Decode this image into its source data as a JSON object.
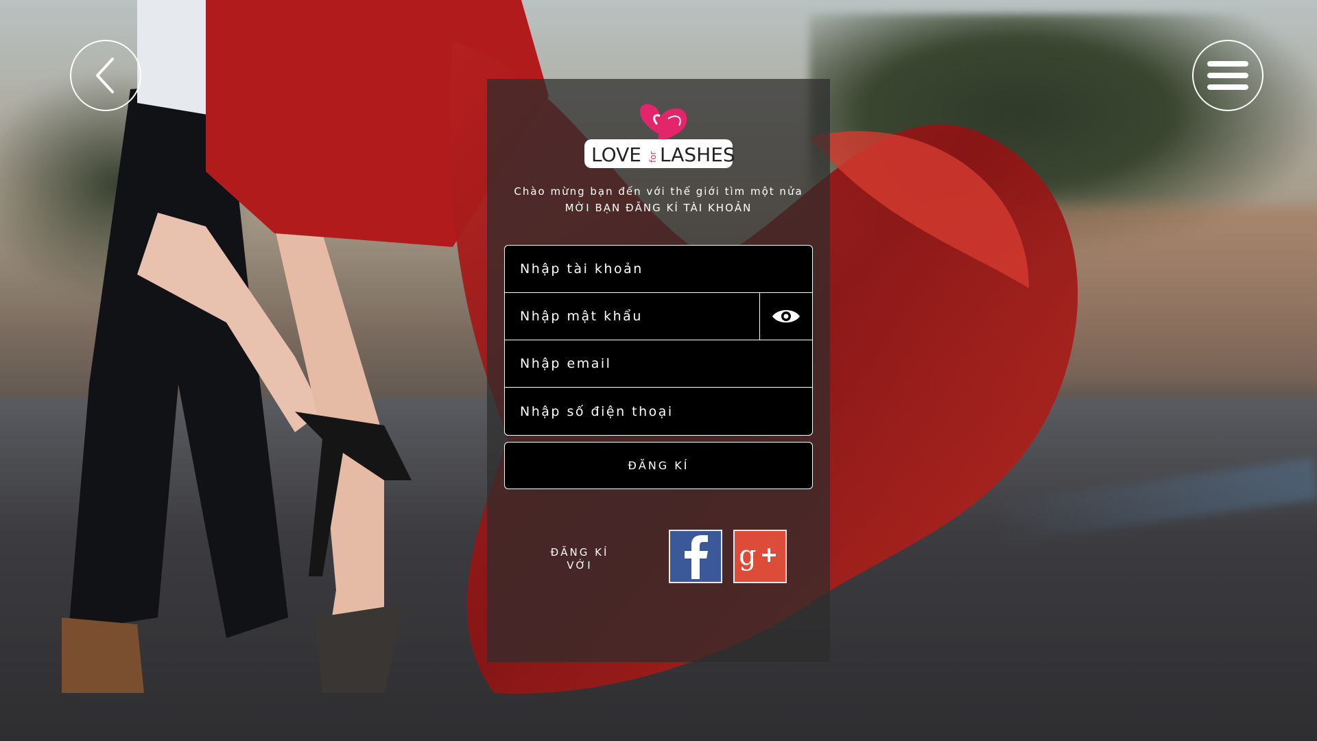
{
  "header": {
    "back_icon": "chevron-left-icon",
    "menu_icon": "hamburger-menu-icon"
  },
  "logo": {
    "text_love": "LOVE",
    "text_for": "for",
    "text_lashes": "LASHES",
    "brand_pink": "#e3256b"
  },
  "welcome": {
    "line1": "Chào mừng bạn đến với thế giới tìm một nửa",
    "line2": "MỜI BẠN ĐĂNG KÍ TÀI KHOẢN"
  },
  "form": {
    "username_placeholder": "Nhập tài khoản",
    "password_placeholder": "Nhập mật khẩu",
    "password_toggle_icon": "eye-icon",
    "email_placeholder": "Nhập email",
    "phone_placeholder": "Nhập số điện thoại",
    "submit_label": "ĐĂNG KÍ"
  },
  "social": {
    "label_line1": "ĐĂNG KÍ",
    "label_line2": "VỚI",
    "facebook_icon": "facebook-icon",
    "google_plus_icon": "google-plus-icon",
    "facebook_color": "#3b5998",
    "google_plus_color": "#dd4b39"
  }
}
